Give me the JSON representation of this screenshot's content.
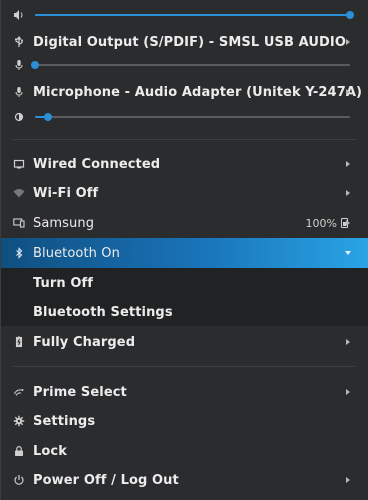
{
  "audio": {
    "output_device": "Digital Output (S/PDIF) - SMSL USB AUDIO",
    "input_device": "Microphone - Audio Adapter (Unitek Y-247A)",
    "output_volume": 1.0,
    "input_volume": 0.0,
    "brightness_level": 0.04
  },
  "network": {
    "wired": "Wired Connected",
    "wifi": "Wi-Fi Off",
    "device": "Samsung",
    "device_battery": "100%"
  },
  "bluetooth": {
    "status": "Bluetooth On",
    "items": [
      "Turn Off",
      "Bluetooth Settings"
    ]
  },
  "power": {
    "battery": "Fully Charged"
  },
  "system": {
    "prime": "Prime Select",
    "settings": "Settings",
    "lock": "Lock",
    "power_off": "Power Off / Log Out"
  },
  "colors": {
    "accent": "#2a8fd6",
    "highlight_start": "#0f4f80",
    "highlight_end": "#2aa4e5",
    "background": "#2b2c2e"
  }
}
